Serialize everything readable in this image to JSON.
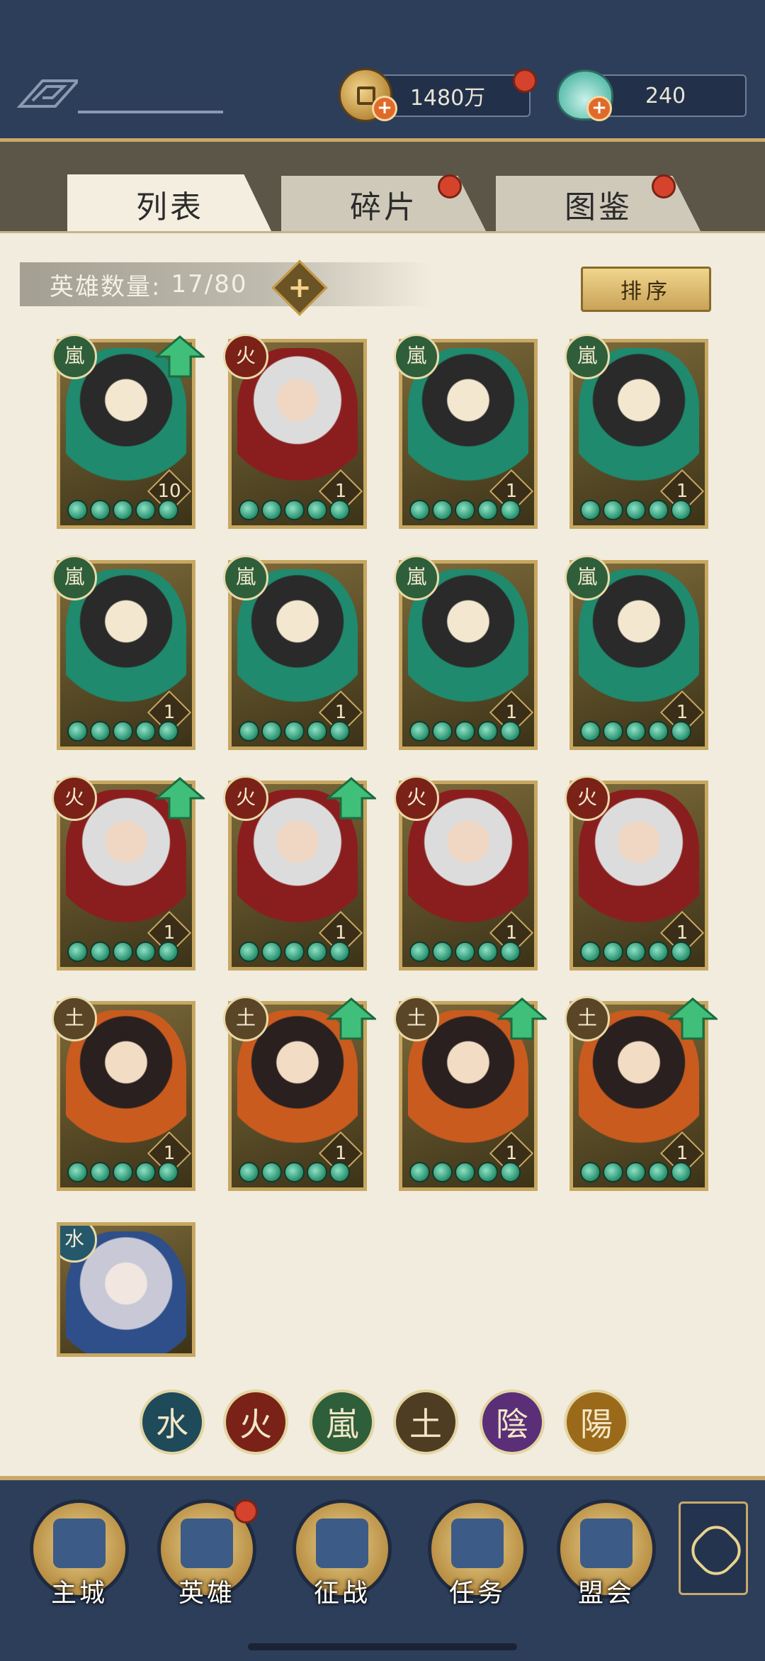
{
  "currency": {
    "coins": "1480万",
    "shells": "240"
  },
  "tabs": [
    {
      "label": "列表",
      "active": true
    },
    {
      "label": "碎片",
      "active": false
    },
    {
      "label": "图鉴",
      "active": false
    }
  ],
  "hero_count": {
    "label": "英雄数量:",
    "value": "17/80",
    "plus": "+"
  },
  "sort_label": "排序",
  "heroes": [
    {
      "element": "嵐",
      "element_type": "wind",
      "level": "10",
      "upgrade": true
    },
    {
      "element": "火",
      "element_type": "fire",
      "level": "1",
      "upgrade": false
    },
    {
      "element": "嵐",
      "element_type": "wind",
      "level": "1",
      "upgrade": false
    },
    {
      "element": "嵐",
      "element_type": "wind",
      "level": "1",
      "upgrade": false
    },
    {
      "element": "嵐",
      "element_type": "wind",
      "level": "1",
      "upgrade": false
    },
    {
      "element": "嵐",
      "element_type": "wind",
      "level": "1",
      "upgrade": false
    },
    {
      "element": "嵐",
      "element_type": "wind",
      "level": "1",
      "upgrade": false
    },
    {
      "element": "嵐",
      "element_type": "wind",
      "level": "1",
      "upgrade": false
    },
    {
      "element": "火",
      "element_type": "fire",
      "level": "1",
      "upgrade": true
    },
    {
      "element": "火",
      "element_type": "fire",
      "level": "1",
      "upgrade": true
    },
    {
      "element": "火",
      "element_type": "fire",
      "level": "1",
      "upgrade": false
    },
    {
      "element": "火",
      "element_type": "fire",
      "level": "1",
      "upgrade": false
    },
    {
      "element": "土",
      "element_type": "earth",
      "level": "1",
      "upgrade": false
    },
    {
      "element": "土",
      "element_type": "earth",
      "level": "1",
      "upgrade": true
    },
    {
      "element": "土",
      "element_type": "earth",
      "level": "1",
      "upgrade": true
    },
    {
      "element": "土",
      "element_type": "earth",
      "level": "1",
      "upgrade": true
    },
    {
      "element": "水",
      "element_type": "water",
      "level": "",
      "upgrade": false
    }
  ],
  "filters": [
    {
      "label": "水",
      "color": "#1f4a5a"
    },
    {
      "label": "火",
      "color": "#7a2218"
    },
    {
      "label": "嵐",
      "color": "#2f5e3a"
    },
    {
      "label": "土",
      "color": "#4e3d22"
    },
    {
      "label": "陰",
      "color": "#5a2f78"
    },
    {
      "label": "陽",
      "color": "#9a6a1a"
    }
  ],
  "nav": [
    {
      "label": "主城",
      "icon": "palace-icon"
    },
    {
      "label": "英雄",
      "icon": "hero-icon"
    },
    {
      "label": "征战",
      "icon": "horn-icon"
    },
    {
      "label": "任务",
      "icon": "scroll-icon"
    },
    {
      "label": "盟会",
      "icon": "pavilion-icon"
    }
  ],
  "colors": {
    "top_bar": "#2d3e5a",
    "panel": "#f1ecde",
    "gold": "#c7a761",
    "notification": "#d6432d"
  }
}
